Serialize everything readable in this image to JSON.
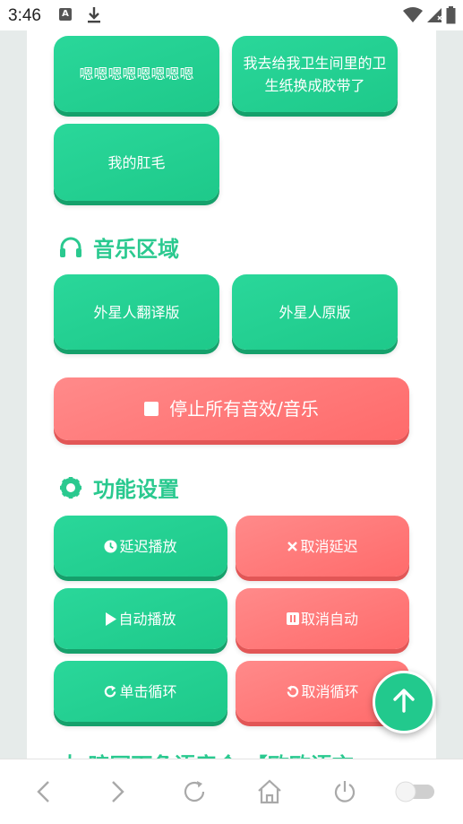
{
  "status_bar": {
    "time": "3:46",
    "app_icon_letter": "A"
  },
  "sound_buttons": [
    {
      "label": "嗯嗯嗯嗯嗯嗯嗯嗯"
    },
    {
      "label": "我去给我卫生间里的卫生纸换成胶带了"
    },
    {
      "label": "我的肛毛"
    }
  ],
  "music_section": {
    "title": "音乐区域",
    "buttons": [
      {
        "label": "外星人翻译版"
      },
      {
        "label": "外星人原版"
      }
    ],
    "stop_label": "停止所有音效/音乐"
  },
  "settings_section": {
    "title": "功能设置",
    "buttons": [
      {
        "label": "延迟播放"
      },
      {
        "label": "取消延迟"
      },
      {
        "label": "自动播放"
      },
      {
        "label": "取消自动"
      },
      {
        "label": "单击循环"
      },
      {
        "label": "取消循环"
      }
    ]
  },
  "next_section_partial": "大 暗网下角语音合 【欧欧语言",
  "colors": {
    "accent_green": "#22c98d",
    "accent_red": "#ff6b6b"
  }
}
